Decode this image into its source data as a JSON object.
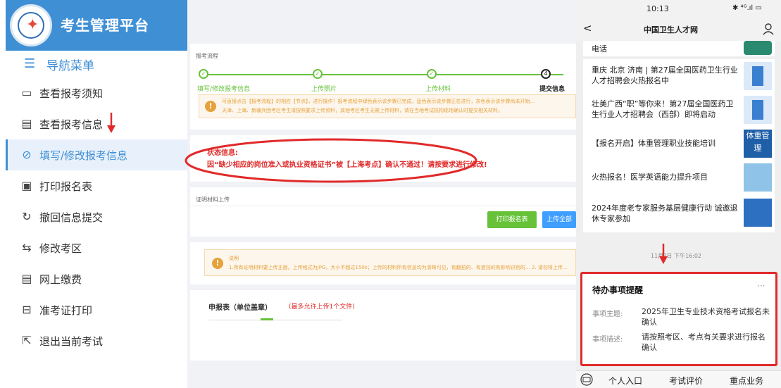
{
  "sidebar": {
    "brand_title": "考生管理平台",
    "nav_header": "导航菜单",
    "items": [
      {
        "label": "查看报考须知",
        "icon": "message-icon"
      },
      {
        "label": "查看报考信息",
        "icon": "document-icon"
      },
      {
        "label": "填写/修改报考信息",
        "icon": "check-circle-icon",
        "active": true
      },
      {
        "label": "打印报名表",
        "icon": "print-icon"
      },
      {
        "label": "撤回信息提交",
        "icon": "refresh-icon"
      },
      {
        "label": "修改考区",
        "icon": "swap-icon"
      },
      {
        "label": "网上缴费",
        "icon": "document-icon"
      },
      {
        "label": "准考证打印",
        "icon": "ticket-icon"
      },
      {
        "label": "退出当前考试",
        "icon": "exit-icon"
      }
    ]
  },
  "main": {
    "flow_title": "报考流程",
    "steps": [
      {
        "label": "填写/修改报考信息",
        "state": "done"
      },
      {
        "label": "上传照片",
        "state": "done"
      },
      {
        "label": "上传材料",
        "state": "done"
      },
      {
        "number": "4",
        "label": "提交信息",
        "state": "current"
      }
    ],
    "flow_tip": "可直接点击【报考流程】的相应【节点】，进行操作！报考流程中绿色表示该步骤已完成，蓝色表示该步骤正在进行，灰色表示该步骤尚未开始…",
    "flow_tip2": "天津、上海、新疆兵团考区考生请按照要求上传资料，其他考区考生无需上传材料，请在当地考试机构现场确认时提交相关材料。",
    "status_label": "状态信息:",
    "status_message": "因“缺少相应的岗位准入或执业资格证书”被【上海考点】确认不通过！请按要求进行修改!",
    "upload_title": "证明材料上传",
    "print_button": "打印报名表",
    "upload_all_button": "上传全部",
    "note_label": "说明",
    "note_text": "1.所有证明材料要上传正面。上传格式为JPG，大小不超过150k；上传的材料所有信息均为清晰可见，有翻拍的、有遮挡的有影响识别的…  2. 请勿将上传…",
    "form_title": "申报表（单位盖章）",
    "form_limit": "(最多允许上传1个文件)"
  },
  "phone": {
    "time": "10:13",
    "signal": "✱ ⁴ᴳ.ıl ▭",
    "back": "<",
    "title": "中国卫生人才网",
    "articles": [
      {
        "title": "电话",
        "thumb": "phone-thumb"
      },
      {
        "title": "重庆 北京 济南 | 第27届全国医药卫生行业人才招聘会火热报名中",
        "thumb": "building-thumb"
      },
      {
        "title": "壮美广西“职”等你来！第27届全国医药卫生行业人才招聘会（西部）即将启动",
        "thumb": "building-thumb"
      },
      {
        "title": "【报名开启】体重管理职业技能培训",
        "thumb": "体重管理"
      },
      {
        "title": "火热报名！医学英语能力提升项目",
        "thumb": "english-thumb"
      },
      {
        "title": "2024年度老专家服务基层健康行动 诚邀退休专家参加",
        "thumb": "expert-thumb"
      }
    ],
    "timestamp": "11月?日 下午16:02",
    "todo": {
      "title": "待办事项提醒",
      "more": "···",
      "subject_label": "事项主题:",
      "subject_value": "2025年卫生专业技术资格考试报名未确认",
      "desc_label": "事项描述:",
      "desc_value": "请按照考区、考点有关要求进行报名确认"
    },
    "bottom_menu": [
      "个人入口",
      "考试评价",
      "重点业务"
    ]
  },
  "colors": {
    "brand": "#3f8fd5",
    "success": "#67c23a",
    "primary": "#409eff",
    "warning": "#e6a23c",
    "annotation": "#e02a2a"
  }
}
